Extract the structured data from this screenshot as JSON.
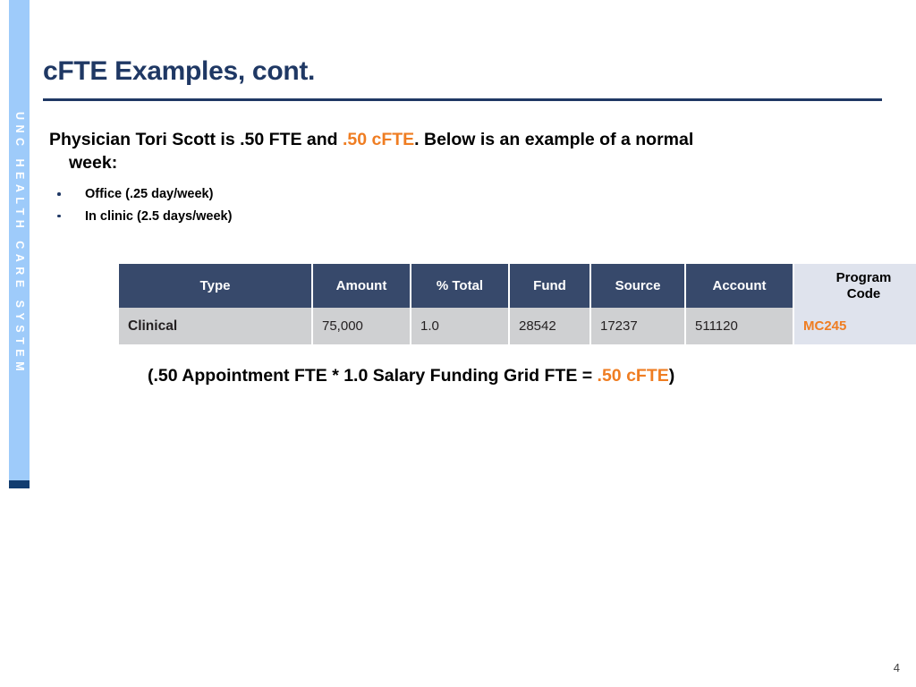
{
  "brand": {
    "rail_text": "UNC HEALTH CARE SYSTEM",
    "rail_color": "#9ecbfa",
    "rail_foot_color": "#123d70"
  },
  "slide": {
    "title": "cFTE Examples, cont.",
    "title_color": "#1f3864",
    "accent_color": "#ef7d22",
    "page_number": "4"
  },
  "intro": {
    "line1_part1": "Physician Tori Scott is .50 FTE and ",
    "line1_accent": ".50 cFTE",
    "line1_part2": ".  Below is an example of a normal",
    "line2": "week:",
    "bullets": [
      {
        "label": "Office (.25 day/week)"
      },
      {
        "label": "In clinic (2.5 days/week)"
      }
    ]
  },
  "table": {
    "headers": [
      "Type",
      "Amount",
      "% Total",
      "Fund",
      "Source",
      "Account",
      "Program Code"
    ],
    "header_program_line1": "Program",
    "header_program_line2": "Code",
    "rows": [
      {
        "type": "Clinical",
        "amount": "75,000",
        "pct_total": "1.0",
        "fund": "28542",
        "source": "17237",
        "account": "511120",
        "program_code": "MC245"
      }
    ],
    "header_bg": "#37496b",
    "header_text": "#ffffff",
    "header_accent_bg": "#dfe3ed",
    "row_bg": "#cfd0d2",
    "row_accent_bg": "#dfe3ed",
    "row_accent_text": "#ef7d22"
  },
  "formula": {
    "part1": "(.50 Appointment FTE  * 1.0 Salary Funding Grid FTE = ",
    "accent": ".50 cFTE",
    "part2": ")"
  }
}
